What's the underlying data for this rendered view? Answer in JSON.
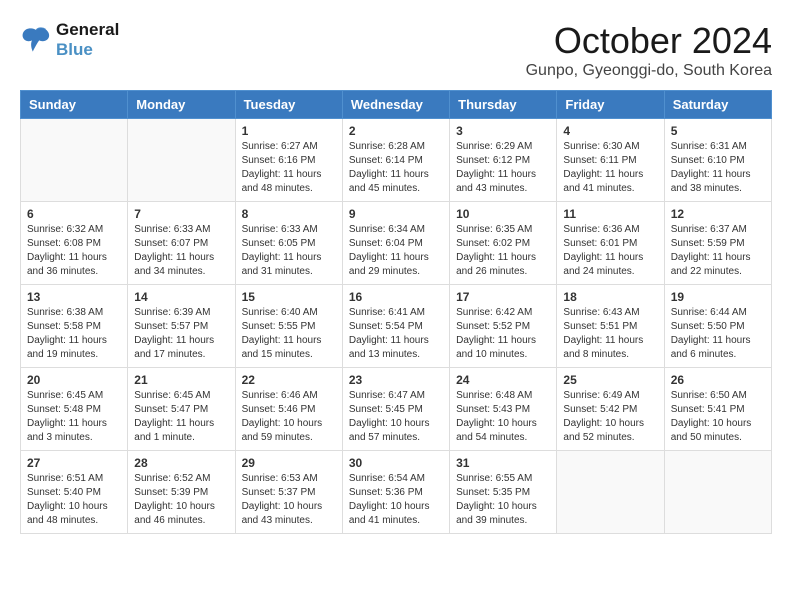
{
  "logo": {
    "line1": "General",
    "line2": "Blue"
  },
  "title": "October 2024",
  "location": "Gunpo, Gyeonggi-do, South Korea",
  "days_of_week": [
    "Sunday",
    "Monday",
    "Tuesday",
    "Wednesday",
    "Thursday",
    "Friday",
    "Saturday"
  ],
  "weeks": [
    [
      {
        "day": "",
        "info": ""
      },
      {
        "day": "",
        "info": ""
      },
      {
        "day": "1",
        "info": "Sunrise: 6:27 AM\nSunset: 6:16 PM\nDaylight: 11 hours and 48 minutes."
      },
      {
        "day": "2",
        "info": "Sunrise: 6:28 AM\nSunset: 6:14 PM\nDaylight: 11 hours and 45 minutes."
      },
      {
        "day": "3",
        "info": "Sunrise: 6:29 AM\nSunset: 6:12 PM\nDaylight: 11 hours and 43 minutes."
      },
      {
        "day": "4",
        "info": "Sunrise: 6:30 AM\nSunset: 6:11 PM\nDaylight: 11 hours and 41 minutes."
      },
      {
        "day": "5",
        "info": "Sunrise: 6:31 AM\nSunset: 6:10 PM\nDaylight: 11 hours and 38 minutes."
      }
    ],
    [
      {
        "day": "6",
        "info": "Sunrise: 6:32 AM\nSunset: 6:08 PM\nDaylight: 11 hours and 36 minutes."
      },
      {
        "day": "7",
        "info": "Sunrise: 6:33 AM\nSunset: 6:07 PM\nDaylight: 11 hours and 34 minutes."
      },
      {
        "day": "8",
        "info": "Sunrise: 6:33 AM\nSunset: 6:05 PM\nDaylight: 11 hours and 31 minutes."
      },
      {
        "day": "9",
        "info": "Sunrise: 6:34 AM\nSunset: 6:04 PM\nDaylight: 11 hours and 29 minutes."
      },
      {
        "day": "10",
        "info": "Sunrise: 6:35 AM\nSunset: 6:02 PM\nDaylight: 11 hours and 26 minutes."
      },
      {
        "day": "11",
        "info": "Sunrise: 6:36 AM\nSunset: 6:01 PM\nDaylight: 11 hours and 24 minutes."
      },
      {
        "day": "12",
        "info": "Sunrise: 6:37 AM\nSunset: 5:59 PM\nDaylight: 11 hours and 22 minutes."
      }
    ],
    [
      {
        "day": "13",
        "info": "Sunrise: 6:38 AM\nSunset: 5:58 PM\nDaylight: 11 hours and 19 minutes."
      },
      {
        "day": "14",
        "info": "Sunrise: 6:39 AM\nSunset: 5:57 PM\nDaylight: 11 hours and 17 minutes."
      },
      {
        "day": "15",
        "info": "Sunrise: 6:40 AM\nSunset: 5:55 PM\nDaylight: 11 hours and 15 minutes."
      },
      {
        "day": "16",
        "info": "Sunrise: 6:41 AM\nSunset: 5:54 PM\nDaylight: 11 hours and 13 minutes."
      },
      {
        "day": "17",
        "info": "Sunrise: 6:42 AM\nSunset: 5:52 PM\nDaylight: 11 hours and 10 minutes."
      },
      {
        "day": "18",
        "info": "Sunrise: 6:43 AM\nSunset: 5:51 PM\nDaylight: 11 hours and 8 minutes."
      },
      {
        "day": "19",
        "info": "Sunrise: 6:44 AM\nSunset: 5:50 PM\nDaylight: 11 hours and 6 minutes."
      }
    ],
    [
      {
        "day": "20",
        "info": "Sunrise: 6:45 AM\nSunset: 5:48 PM\nDaylight: 11 hours and 3 minutes."
      },
      {
        "day": "21",
        "info": "Sunrise: 6:45 AM\nSunset: 5:47 PM\nDaylight: 11 hours and 1 minute."
      },
      {
        "day": "22",
        "info": "Sunrise: 6:46 AM\nSunset: 5:46 PM\nDaylight: 10 hours and 59 minutes."
      },
      {
        "day": "23",
        "info": "Sunrise: 6:47 AM\nSunset: 5:45 PM\nDaylight: 10 hours and 57 minutes."
      },
      {
        "day": "24",
        "info": "Sunrise: 6:48 AM\nSunset: 5:43 PM\nDaylight: 10 hours and 54 minutes."
      },
      {
        "day": "25",
        "info": "Sunrise: 6:49 AM\nSunset: 5:42 PM\nDaylight: 10 hours and 52 minutes."
      },
      {
        "day": "26",
        "info": "Sunrise: 6:50 AM\nSunset: 5:41 PM\nDaylight: 10 hours and 50 minutes."
      }
    ],
    [
      {
        "day": "27",
        "info": "Sunrise: 6:51 AM\nSunset: 5:40 PM\nDaylight: 10 hours and 48 minutes."
      },
      {
        "day": "28",
        "info": "Sunrise: 6:52 AM\nSunset: 5:39 PM\nDaylight: 10 hours and 46 minutes."
      },
      {
        "day": "29",
        "info": "Sunrise: 6:53 AM\nSunset: 5:37 PM\nDaylight: 10 hours and 43 minutes."
      },
      {
        "day": "30",
        "info": "Sunrise: 6:54 AM\nSunset: 5:36 PM\nDaylight: 10 hours and 41 minutes."
      },
      {
        "day": "31",
        "info": "Sunrise: 6:55 AM\nSunset: 5:35 PM\nDaylight: 10 hours and 39 minutes."
      },
      {
        "day": "",
        "info": ""
      },
      {
        "day": "",
        "info": ""
      }
    ]
  ]
}
